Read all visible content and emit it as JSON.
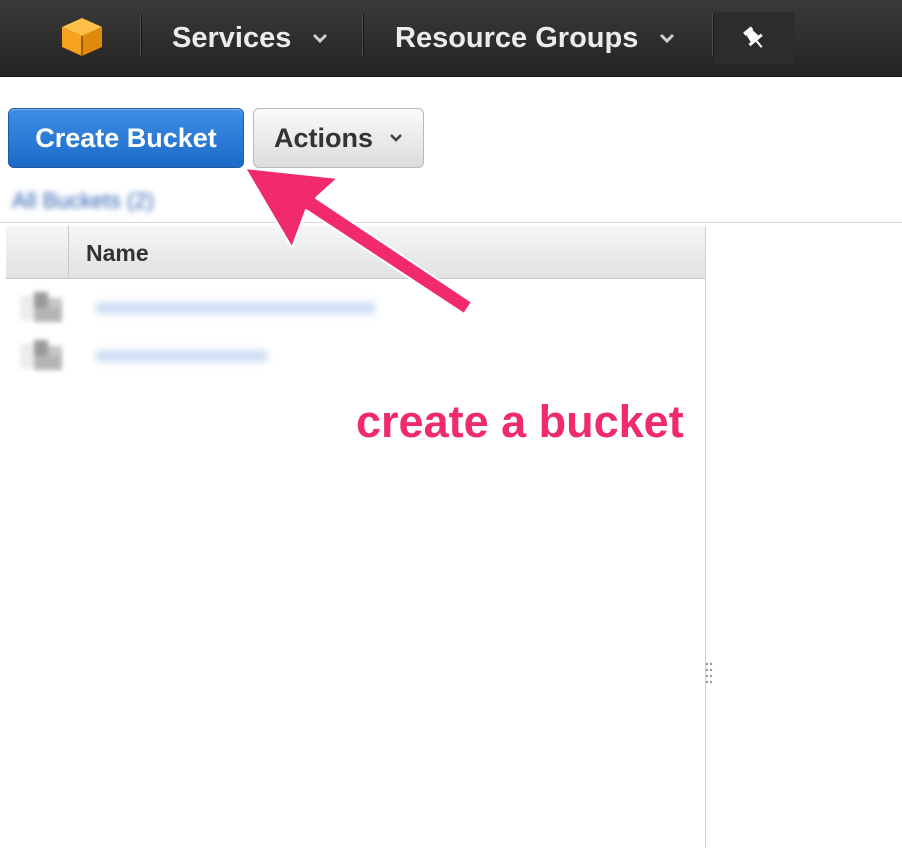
{
  "nav": {
    "logo_icon": "aws-cube-logo-icon",
    "services_label": "Services",
    "resource_groups_label": "Resource Groups",
    "pin_icon": "pushpin-icon",
    "chevron_icon": "chevron-down-icon"
  },
  "toolbar": {
    "create_bucket_label": "Create Bucket",
    "actions_label": "Actions"
  },
  "breadcrumb": {
    "all_buckets_label": "All Buckets (2)"
  },
  "table": {
    "columns": [
      "Name"
    ],
    "rows": [
      {
        "name": "xxxxxxxxxxxxxxxxxxxxxxxxxxxxxxx",
        "icon": "bucket-icon"
      },
      {
        "name": "xxxxxxxxxxxxxxxxxxx",
        "icon": "bucket-icon"
      }
    ]
  },
  "annotation": {
    "text": "create a bucket",
    "color": "#f02a6c"
  },
  "colors": {
    "primary_button": "#1c6ac8",
    "nav_background": "#232323",
    "aws_orange": "#f7a21c"
  }
}
